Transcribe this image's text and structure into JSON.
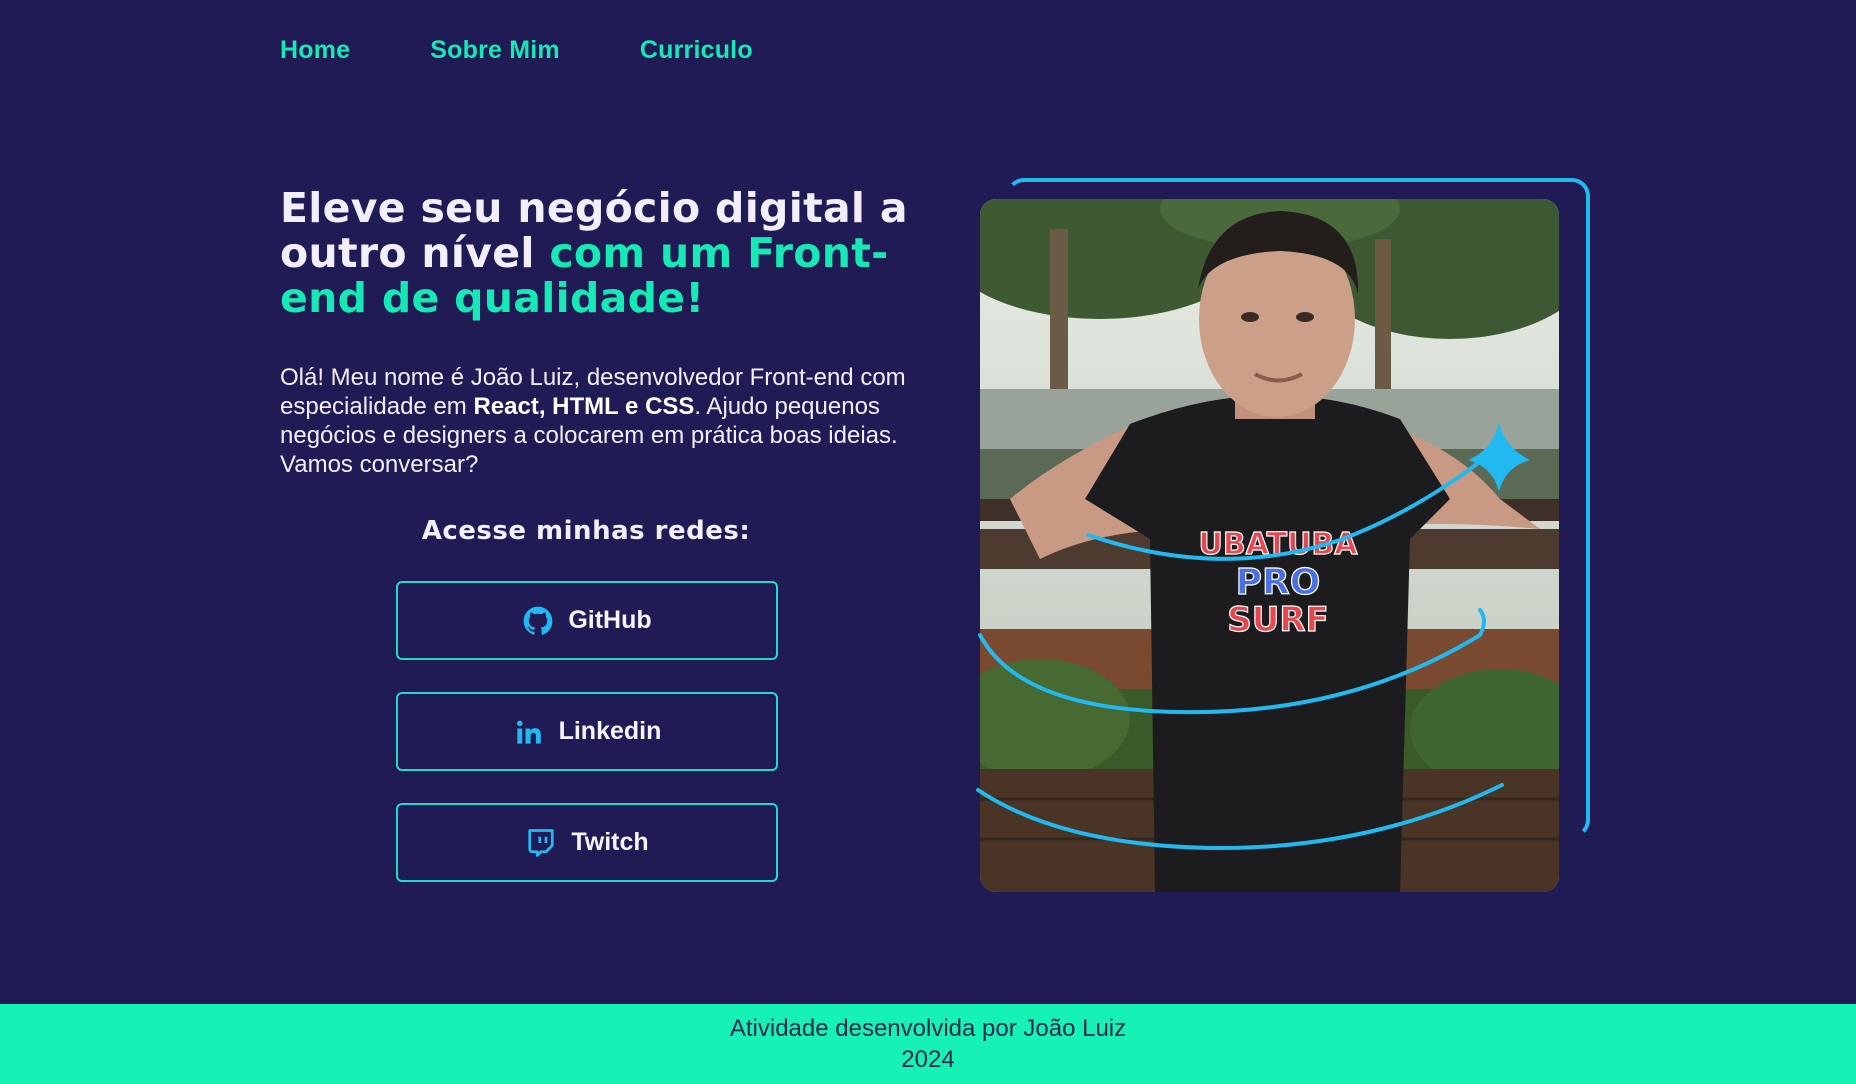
{
  "nav": {
    "items": [
      {
        "label": "Home"
      },
      {
        "label": "Sobre Mim"
      },
      {
        "label": "Curriculo"
      }
    ]
  },
  "hero": {
    "headline_white": "Eleve seu negócio digital a outro nível",
    "headline_accent": "com um Front-end de qualidade!",
    "intro_part1": "Olá! Meu nome é João Luiz, desenvolvedor Front-end com especialidade em",
    "intro_strong": "React, HTML e CSS",
    "intro_part2": ". Ajudo pequenos negócios e designers a colocarem em prática boas ideias. Vamos conversar?"
  },
  "socials": {
    "title": "Acesse minhas redes:",
    "buttons": [
      {
        "label": "GitHub",
        "icon": "github-icon"
      },
      {
        "label": "Linkedin",
        "icon": "linkedin-icon"
      },
      {
        "label": "Twitch",
        "icon": "twitch-icon"
      }
    ]
  },
  "photo": {
    "shirt_text": [
      "UBATUBA",
      "PRO",
      "SURF"
    ]
  },
  "footer": {
    "line1": "Atividade desenvolvida por João Luiz",
    "line2": "2024"
  },
  "colors": {
    "background": "#201b54",
    "accent": "#16e8b6",
    "border": "#22d9cc",
    "footer_bg": "#16f1b6",
    "decor_blue": "#22b9f0"
  }
}
